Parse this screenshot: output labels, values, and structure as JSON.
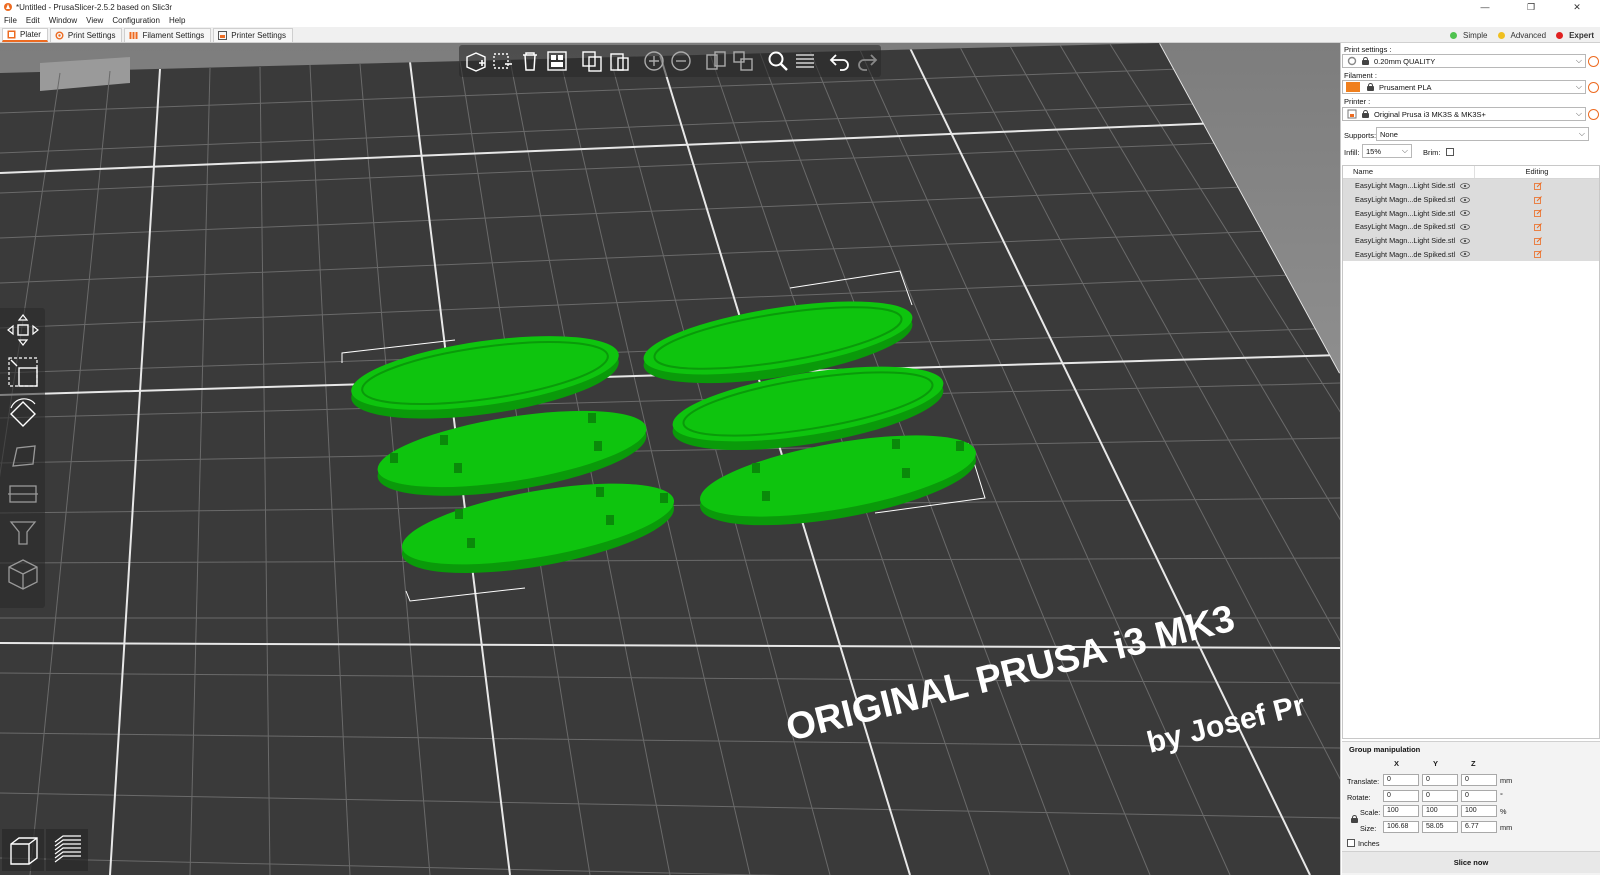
{
  "window": {
    "title": "*Untitled - PrusaSlicer-2.5.2 based on Slic3r",
    "controls": [
      "—",
      "❐",
      "✕"
    ]
  },
  "menu": [
    "File",
    "Edit",
    "Window",
    "View",
    "Configuration",
    "Help"
  ],
  "tabs": [
    {
      "label": "Plater",
      "active": true
    },
    {
      "label": "Print Settings",
      "active": false
    },
    {
      "label": "Filament Settings",
      "active": false
    },
    {
      "label": "Printer Settings",
      "active": false
    }
  ],
  "modes": [
    {
      "label": "Simple",
      "color": "#4fc24f",
      "active": false
    },
    {
      "label": "Advanced",
      "color": "#f0c020",
      "active": false
    },
    {
      "label": "Expert",
      "color": "#e02020",
      "active": true
    }
  ],
  "sidebar": {
    "print_settings_label": "Print settings :",
    "print_settings_value": "0.20mm QUALITY",
    "filament_label": "Filament :",
    "filament_value": "Prusament PLA",
    "filament_color": "#f07f1d",
    "printer_label": "Printer :",
    "printer_value": "Original Prusa i3 MK3S & MK3S+",
    "supports_label": "Supports:",
    "supports_value": "None",
    "infill_label": "Infill:",
    "infill_value": "15%",
    "brim_label": "Brim:",
    "brim_checked": false
  },
  "object_list": {
    "col_name": "Name",
    "col_editing": "Editing",
    "items": [
      "EasyLight Magn...Light Side.stl",
      "EasyLight Magn...de Spiked.stl",
      "EasyLight Magn...Light Side.stl",
      "EasyLight Magn...de Spiked.stl",
      "EasyLight Magn...Light Side.stl",
      "EasyLight Magn...de Spiked.stl"
    ]
  },
  "group_manipulation": {
    "title": "Group manipulation",
    "axes": [
      "X",
      "Y",
      "Z"
    ],
    "translate_label": "Translate:",
    "translate": [
      "0",
      "0",
      "0"
    ],
    "translate_unit": "mm",
    "rotate_label": "Rotate:",
    "rotate": [
      "0",
      "0",
      "0"
    ],
    "rotate_unit": "°",
    "scale_label": "Scale:",
    "scale": [
      "100",
      "100",
      "100"
    ],
    "scale_unit": "%",
    "size_label": "Size:",
    "size": [
      "106.68",
      "58.05",
      "6.77"
    ],
    "size_unit": "mm",
    "inches_label": "Inches",
    "inches_checked": false
  },
  "slice_button": "Slice now",
  "bed": {
    "logo_line1": "ORIGINAL PRUSA i3  MK3",
    "logo_line2": "by Josef Pr",
    "object_color": "#0ec40e",
    "bed_color": "#3a3a3a"
  }
}
